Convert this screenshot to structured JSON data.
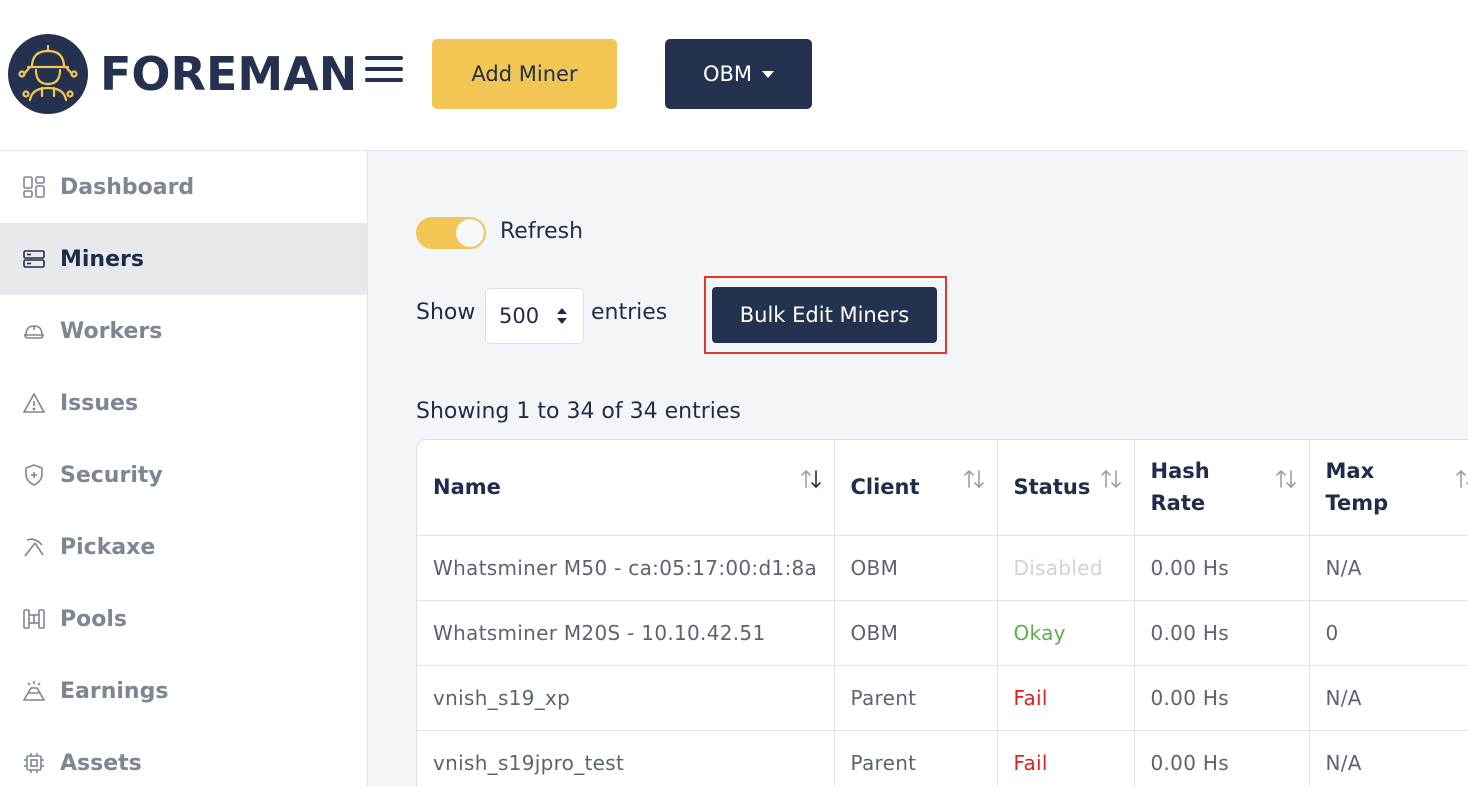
{
  "header": {
    "brand": "FOREMAN",
    "add_miner_label": "Add Miner",
    "client_select_label": "OBM"
  },
  "sidebar": {
    "items": [
      {
        "label": "Dashboard",
        "icon": "dashboard-icon"
      },
      {
        "label": "Miners",
        "icon": "server-icon",
        "active": true
      },
      {
        "label": "Workers",
        "icon": "hardhat-icon"
      },
      {
        "label": "Issues",
        "icon": "warning-icon"
      },
      {
        "label": "Security",
        "icon": "shield-icon"
      },
      {
        "label": "Pickaxe",
        "icon": "pickaxe-icon"
      },
      {
        "label": "Pools",
        "icon": "pools-icon"
      },
      {
        "label": "Earnings",
        "icon": "earnings-icon"
      },
      {
        "label": "Assets",
        "icon": "chip-icon"
      }
    ]
  },
  "main": {
    "refresh_label": "Refresh",
    "refresh_enabled": true,
    "show_label": "Show",
    "entries_value": "500",
    "entries_label": "entries",
    "bulk_edit_label": "Bulk Edit Miners",
    "showing_text": "Showing 1 to 34 of 34 entries"
  },
  "table": {
    "headers": [
      "Name",
      "Client",
      "Status",
      "Hash Rate",
      "Max Temp"
    ],
    "rows": [
      {
        "name": "Whatsminer M50 - ca:05:17:00:d1:8a",
        "client": "OBM",
        "status": "Disabled",
        "hash_rate": "0.00 Hs",
        "max_temp": "N/A"
      },
      {
        "name": "Whatsminer M20S - 10.10.42.51",
        "client": "OBM",
        "status": "Okay",
        "hash_rate": "0.00 Hs",
        "max_temp": "0"
      },
      {
        "name": "vnish_s19_xp",
        "client": "Parent",
        "status": "Fail",
        "hash_rate": "0.00 Hs",
        "max_temp": "N/A"
      },
      {
        "name": "vnish_s19jpro_test",
        "client": "Parent",
        "status": "Fail",
        "hash_rate": "0.00 Hs",
        "max_temp": "N/A"
      }
    ]
  },
  "colors": {
    "navy": "#25324f",
    "accent_yellow": "#f2c654",
    "status_okay": "#5fae4a",
    "status_fail": "#e02020",
    "status_disabled": "#cfd2d7",
    "highlight_frame": "#e03a2e"
  }
}
